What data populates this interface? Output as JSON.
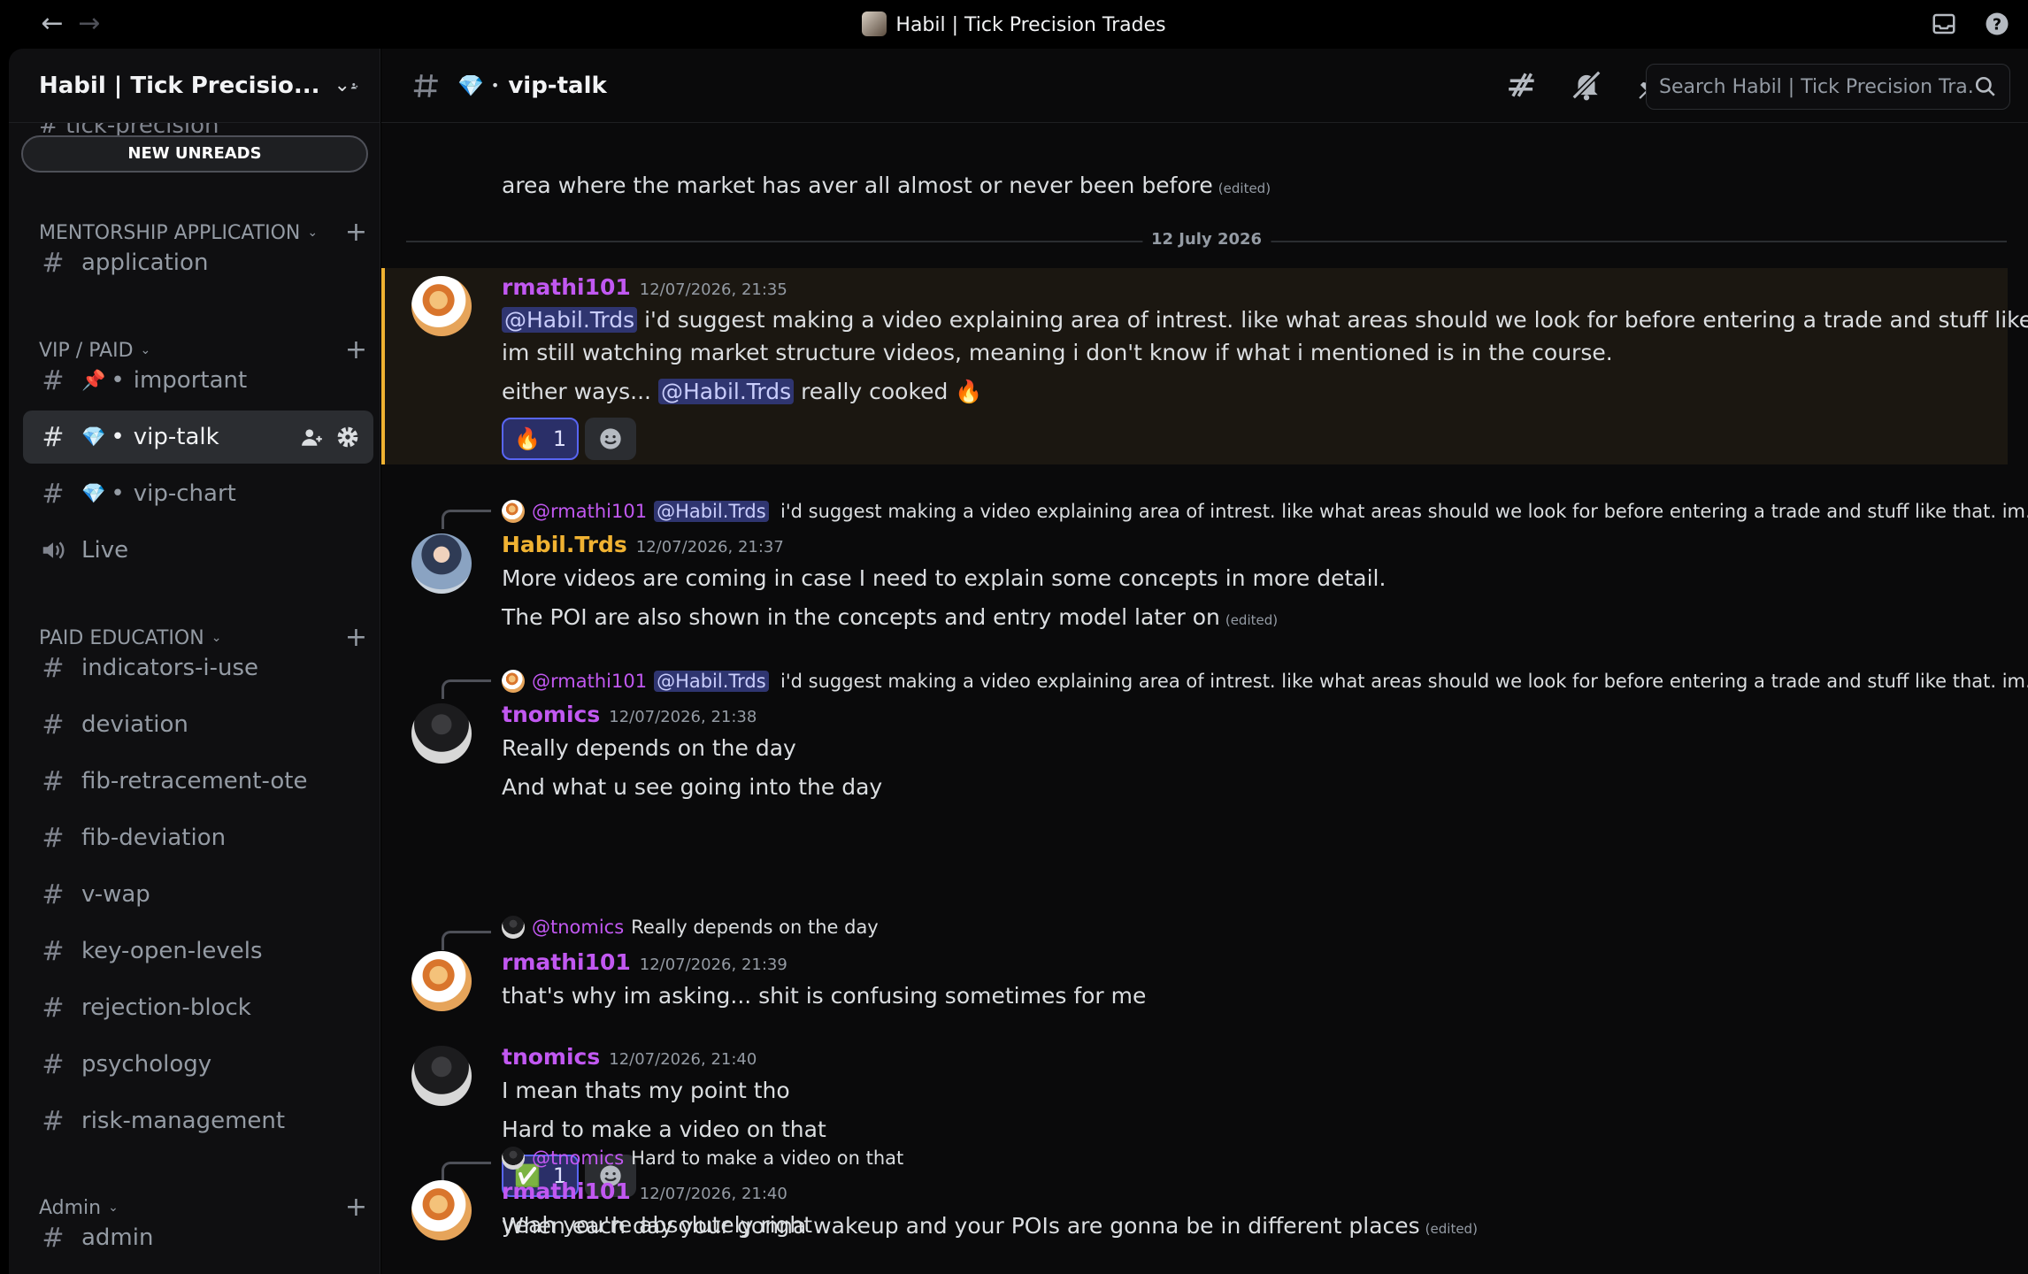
{
  "window": {
    "title": "Habil | Tick Precision Trades"
  },
  "sidebar": {
    "server_name": "Habil | Tick Precisio...",
    "cut_channel": "tick-precision",
    "new_unreads": "NEW UNREADS",
    "categories": [
      {
        "label": "MENTORSHIP APPLICATION"
      },
      {
        "label": "VIP / PAID"
      },
      {
        "label": "PAID EDUCATION"
      },
      {
        "label": "Admin"
      }
    ],
    "channels": {
      "application": "application",
      "important": "important",
      "vip_talk": "vip-talk",
      "vip_chart": "vip-chart",
      "live": "Live",
      "indicators": "indicators-i-use",
      "deviation": "deviation",
      "fib_ote": "fib-retracement-ote",
      "fib_dev": "fib-deviation",
      "vwap": "v-wap",
      "key_open": "key-open-levels",
      "rejection": "rejection-block",
      "psychology": "psychology",
      "risk": "risk-management",
      "admin": "admin"
    },
    "icons": {
      "pin": "📌",
      "gem": "💎",
      "separator": "•"
    }
  },
  "header": {
    "channel_emoji": "💎",
    "channel_dot": "•",
    "channel_name": "vip-talk",
    "search_placeholder": "Search Habil | Tick Precision Tra..."
  },
  "messages": {
    "top_fragment": "area where the market has aver all almost or never been before",
    "edited_label": "(edited)",
    "date_divider": "12 July 2026",
    "m1": {
      "user": "rmathi101",
      "time": "12/07/2026, 21:35",
      "mention": "@Habil.Trds",
      "line1": "i'd suggest making a video explaining area of intrest. like what areas should we look for before entering a trade and stuff like that.",
      "line2": "im still watching market structure videos, meaning i don't know if what i mentioned is in the course.",
      "line3_pre": "either ways...",
      "line3_mention": "@Habil.Trds",
      "line3_post": "really cooked",
      "line3_emoji": "🔥",
      "reaction_emoji": "🔥",
      "reaction_count": "1"
    },
    "m2": {
      "reply_user": "@rmathi101",
      "reply_mention": "@Habil.Trds",
      "reply_text": "i'd suggest making a video explaining area of intrest. like what areas should we look for before entering a trade and stuff like that. im ...",
      "user": "Habil.Trds",
      "time": "12/07/2026, 21:37",
      "line1": "More videos are coming in case I need to explain some concepts in more detail.",
      "line2": "The POI are also shown in the concepts and entry model later on"
    },
    "m3": {
      "reply_user": "@rmathi101",
      "reply_mention": "@Habil.Trds",
      "reply_text": "i'd suggest making a video explaining area of intrest. like what areas should we look for before entering a trade and stuff like that. im ...",
      "user": "tnomics",
      "time": "12/07/2026, 21:38",
      "line1": "Really depends on the day",
      "line2": "And what u see going into the day"
    },
    "m4": {
      "reply_user": "@tnomics",
      "reply_text": "Really depends on the day",
      "user": "rmathi101",
      "time": "12/07/2026, 21:39",
      "line1": "that's why im asking... shit is confusing sometimes for me"
    },
    "m5": {
      "user": "tnomics",
      "time": "12/07/2026, 21:40",
      "line1": "I mean thats my point tho",
      "line2": "Hard to make a video on that",
      "reaction_emoji": "✅",
      "reaction_count": "1",
      "line3": "When each day your gonna wakeup and your POIs are gonna be in different places"
    },
    "m6": {
      "reply_user": "@tnomics",
      "reply_text": "Hard to make a video on that",
      "user": "rmathi101",
      "time": "12/07/2026, 21:40",
      "line1": "yeah you're absolutely right"
    }
  }
}
